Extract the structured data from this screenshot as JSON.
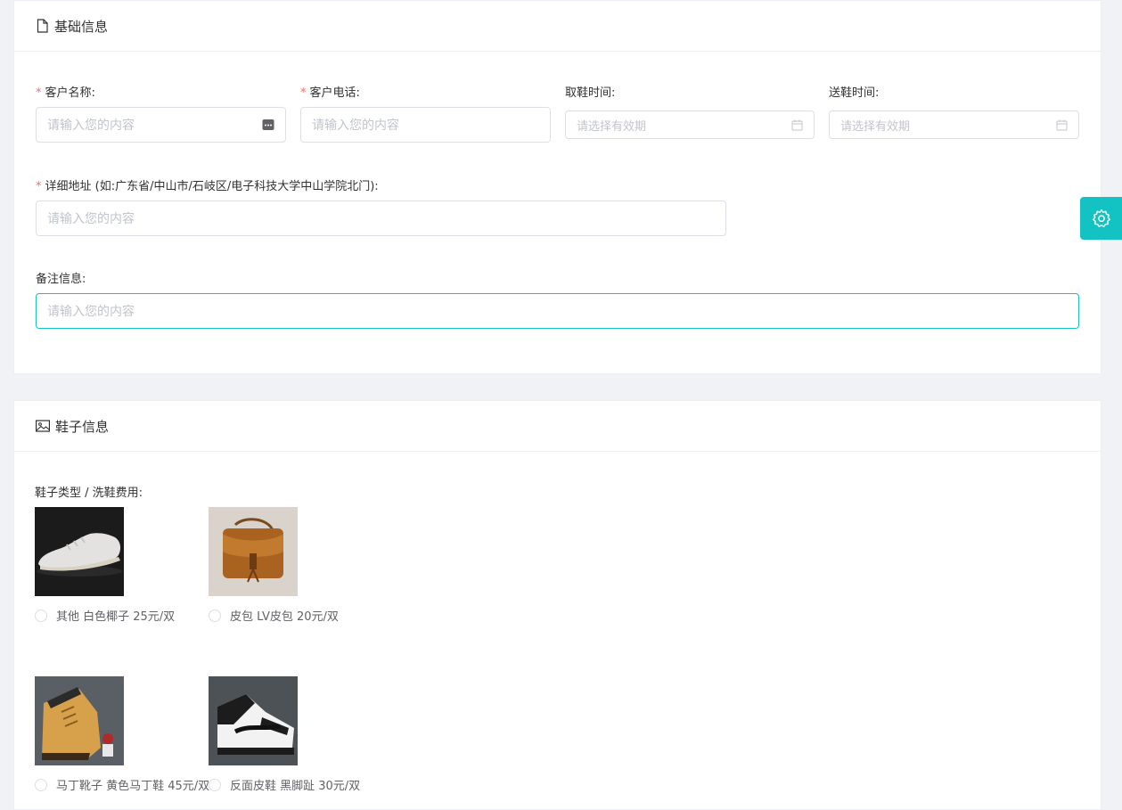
{
  "basic": {
    "title": "基础信息",
    "required_mark": "*",
    "customer_name": {
      "label": "客户名称:",
      "placeholder": "请输入您的内容"
    },
    "customer_phone": {
      "label": "客户电话:",
      "placeholder": "请输入您的内容"
    },
    "pickup_time": {
      "label": "取鞋时间:",
      "placeholder": "请选择有效期"
    },
    "delivery_time": {
      "label": "送鞋时间:",
      "placeholder": "请选择有效期"
    },
    "address": {
      "label": "详细地址 (如:广东省/中山市/石岐区/电子科技大学中山学院北门):",
      "placeholder": "请输入您的内容"
    },
    "remark": {
      "label": "备注信息:",
      "placeholder": "请输入您的内容"
    }
  },
  "shoes": {
    "title": "鞋子信息",
    "type_label": "鞋子类型 / 洗鞋费用:",
    "items": [
      {
        "label": "其他 白色椰子 25元/双",
        "icon": "white-sneaker-photo"
      },
      {
        "label": "皮包 LV皮包 20元/双",
        "icon": "brown-leather-bag-photo"
      },
      {
        "label": "马丁靴子 黄色马丁鞋 45元/双",
        "icon": "yellow-martin-boot-photo"
      },
      {
        "label": "反面皮鞋 黑脚趾 30元/双",
        "icon": "black-white-sneaker-photo"
      }
    ]
  },
  "settings": {
    "icon": "gear-icon"
  },
  "colors": {
    "accent": "#13c2c2",
    "required": "#f56c6c",
    "border": "#dcdfe6",
    "background": "#f0f2f5"
  }
}
